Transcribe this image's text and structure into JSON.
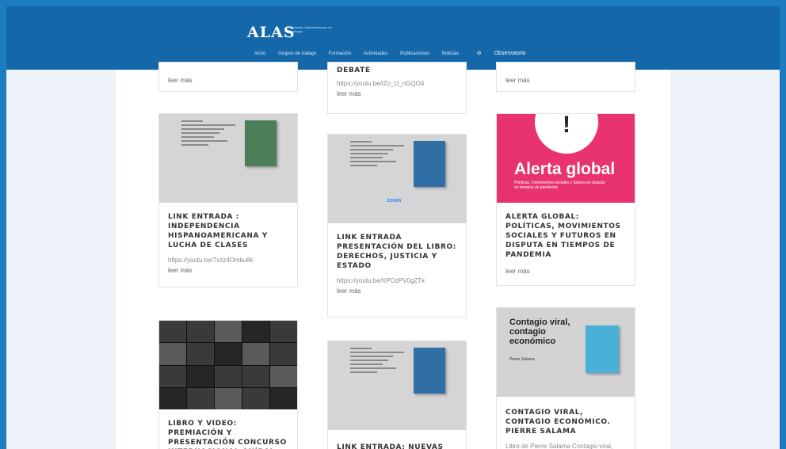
{
  "header": {
    "logo": "ALAS",
    "logo_subtitle": "Asociación Latinoamericana de Sociología",
    "nav": [
      "Inicio",
      "Grupos de trabajo",
      "Formación",
      "Actividades",
      "Publicaciones",
      "Noticias"
    ],
    "observatorio": "Observatorio"
  },
  "top_row": {
    "left_more": "leer más",
    "middle_title": "DEBATE",
    "middle_url": "https://youtu.be/iZo_U_nGQO4",
    "middle_more": "leer más",
    "right_more": "leer más"
  },
  "cards": {
    "c1": {
      "title": "LINK ENTRADA : INDEPENDENCIA HISPANOAMERICANA Y LUCHA DE CLASES",
      "url": "https://youtu.be/7vzz4Omku8k",
      "more": "leer más"
    },
    "c2": {
      "title": "LINK ENTRADA PRESENTACIÓN DEL LIBRO: DERECHOS, JUSTICIA Y ESTADO",
      "url": "https://youtu.be/XPOzPV0gZTk",
      "more": "leer más",
      "zoom": "zoom"
    },
    "c3": {
      "title": "ALERTA GLOBAL: POLÍTICAS, MOVIMIENTOS SOCIALES Y FUTUROS EN DISPUTA EN TIEMPOS DE PANDEMIA",
      "more": "leer más",
      "image_title": "Alerta global",
      "image_sub": "Políticas, movimientos sociales y futuros en disputa en tiempos de pandemia"
    },
    "c4": {
      "title": "LIBRO Y VIDEO: PREMIACIÓN Y PRESENTACIÓN CONCURSO INTERNACIONAL ANÍBAL"
    },
    "c5": {
      "title": "LINK ENTRADA: NUEVAS"
    },
    "c6": {
      "title": "CONTAGIO VIRAL, CONTAGIO ECONÓMICO. PIERRE SALAMA",
      "excerpt": "Libro de Pierre Salama Contagio viral,",
      "image_title": "Contagio viral, contagio económico",
      "image_author": "Pierre Salama"
    }
  }
}
